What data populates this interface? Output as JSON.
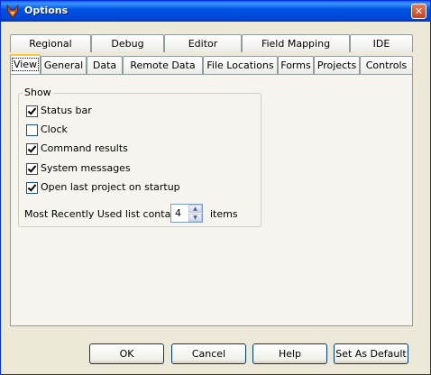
{
  "window": {
    "title": "Options",
    "close_glyph": "✕"
  },
  "tabs_back": [
    "Regional",
    "Debug",
    "Editor",
    "Field Mapping",
    "IDE"
  ],
  "tabs_front": [
    "View",
    "General",
    "Data",
    "Remote Data",
    "File Locations",
    "Forms",
    "Projects",
    "Controls"
  ],
  "active_tab": "View",
  "show_group": {
    "title": "Show",
    "options": [
      {
        "label": "Status bar",
        "checked": true
      },
      {
        "label": "Clock",
        "checked": false
      },
      {
        "label": "Command results",
        "checked": true
      },
      {
        "label": "System messages",
        "checked": true
      },
      {
        "label": "Open last project on startup",
        "checked": true
      }
    ]
  },
  "mru": {
    "label": "Most Recently Used list contains",
    "value": "4",
    "suffix": "items"
  },
  "buttons": {
    "ok": "OK",
    "cancel": "Cancel",
    "help": "Help",
    "default": "Set As Default"
  }
}
